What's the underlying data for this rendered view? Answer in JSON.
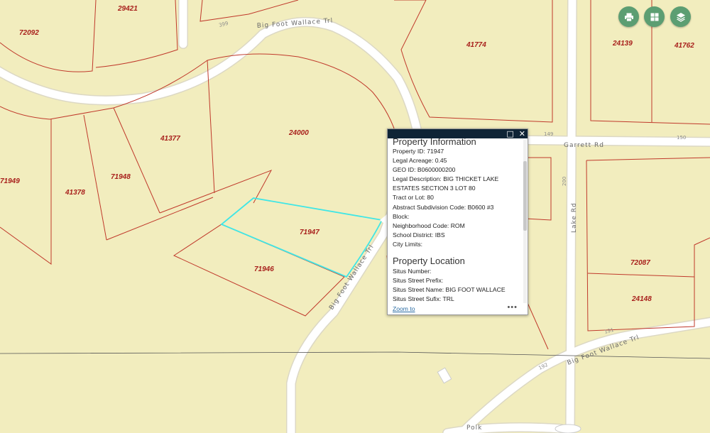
{
  "map": {
    "colors": {
      "land": "#f2edbe",
      "road": "#ffffff",
      "road_casing": "#d6d3c2",
      "parcel_line": "#c0392b",
      "selected_outline": "#3fe6e6",
      "label": "#a8201c"
    },
    "parcels": [
      "29421",
      "72092",
      "41774",
      "24139",
      "41762",
      "24000",
      "41377",
      "71949",
      "41378",
      "71948",
      "71947",
      "71946",
      "72087",
      "24148"
    ],
    "roads": {
      "big_foot_wallace_north": "Big Foot Wallace Trl",
      "big_foot_wallace_diag": "Big Foot Wallace Trl",
      "big_foot_wallace_south": "Big Foot Wallace Trl",
      "garrett": "Garrett Rd",
      "lake": "Lake Rd",
      "polk": "Polk"
    },
    "address_numbers": [
      "399",
      "149",
      "150",
      "200",
      "191",
      "192"
    ]
  },
  "toolbar": {
    "print_icon": "printer-icon",
    "basemap_icon": "grid-icon",
    "layers_icon": "layers-icon"
  },
  "popup": {
    "header_icons": {
      "maximize": "□",
      "close": "✕"
    },
    "section1_title": "Property Information",
    "fields": [
      {
        "label": "Property ID:",
        "value": "71947"
      },
      {
        "label": "Legal Acreage:",
        "value": "0.45"
      },
      {
        "label": "GEO ID:",
        "value": "B0600000200"
      },
      {
        "label": "Legal Description:",
        "value": "BIG THICKET LAKE ESTATES SECTION 3 LOT 80"
      },
      {
        "label": "Tract or Lot:",
        "value": "80"
      },
      {
        "label": "Abstract Subdivision Code:",
        "value": "B0600 #3"
      },
      {
        "label": "Block:",
        "value": ""
      },
      {
        "label": "Neighborhood Code:",
        "value": "ROM"
      },
      {
        "label": "School District:",
        "value": "IBS"
      },
      {
        "label": "City Limits:",
        "value": ""
      }
    ],
    "section2_title": "Property Location",
    "location_fields": [
      {
        "label": "Situs Number:",
        "value": ""
      },
      {
        "label": "Situs Street Prefix:",
        "value": ""
      },
      {
        "label": "Situs Street Name:",
        "value": "BIG FOOT WALLACE"
      },
      {
        "label": "Situs Street Sufix:",
        "value": "TRL"
      }
    ],
    "zoom_label": "Zoom to",
    "more_label": "•••"
  }
}
